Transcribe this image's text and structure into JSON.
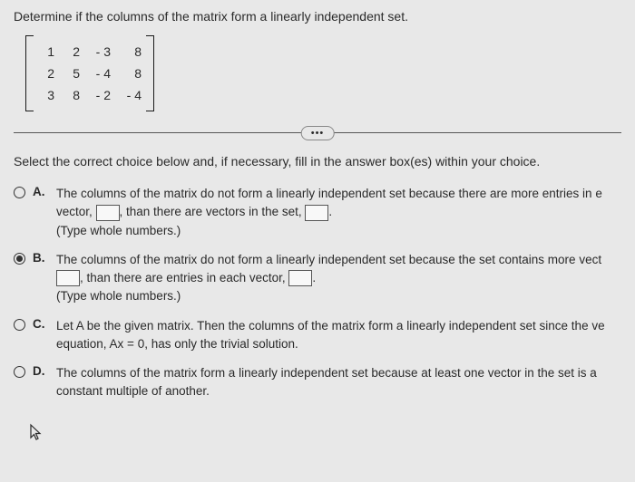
{
  "question": "Determine if the columns of the matrix form a linearly independent set.",
  "matrix": {
    "rows": [
      [
        "1",
        "2",
        "- 3",
        "8"
      ],
      [
        "2",
        "5",
        "- 4",
        "8"
      ],
      [
        "3",
        "8",
        "- 2",
        "- 4"
      ]
    ]
  },
  "divider_label": "•••",
  "instruction": "Select the correct choice below and, if necessary, fill in the answer box(es) within your choice.",
  "choices": {
    "A": {
      "letter": "A.",
      "text_parts": [
        "The columns of the matrix do not form a linearly independent set because there are more entries in e",
        "vector, ",
        ", than there are vectors in the set, ",
        "."
      ],
      "hint": "(Type whole numbers.)",
      "selected": false
    },
    "B": {
      "letter": "B.",
      "text_parts": [
        "The columns of the matrix do not form a linearly independent set because the set contains more vect",
        ", than there are entries in each vector, ",
        "."
      ],
      "hint": "(Type whole numbers.)",
      "selected": true
    },
    "C": {
      "letter": "C.",
      "text": "Let A be the given matrix. Then the columns of the matrix form a linearly independent set since the ve equation, Ax = 0, has only the trivial solution.",
      "selected": false
    },
    "D": {
      "letter": "D.",
      "text": "The columns of the matrix form a linearly independent set because at least one vector in the set is a constant multiple of another.",
      "selected": false
    }
  }
}
